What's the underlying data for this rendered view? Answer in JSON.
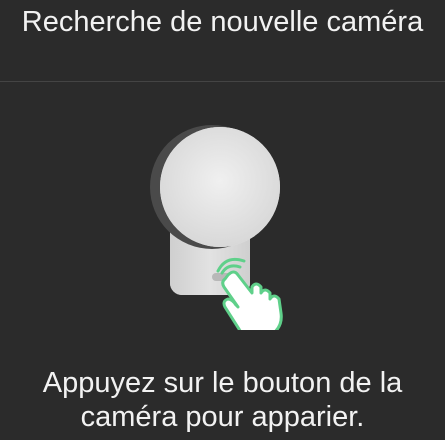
{
  "header": {
    "title": "Recherche de nouvelle caméra"
  },
  "illustration": {
    "icon": "camera-pairing-icon",
    "hand_icon": "tap-hand-icon",
    "accent_color": "#5fd08a"
  },
  "instruction": {
    "line1": "Appuyez sur le bouton de la",
    "line2": "caméra pour apparier."
  },
  "colors": {
    "background": "#2b2b2b",
    "text": "#f2f2f2",
    "divider": "#444444"
  }
}
